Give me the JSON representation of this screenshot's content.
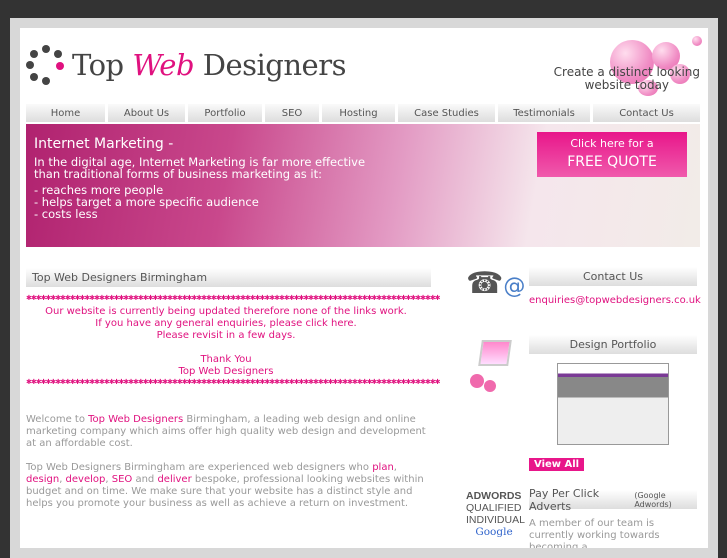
{
  "logo": {
    "part1": "Top ",
    "part2": "Web",
    "part3": " Designers"
  },
  "tagline": {
    "line1": "Create a distinct looking",
    "line2": "website today"
  },
  "nav": [
    "Home",
    "About Us",
    "Portfolio",
    "SEO",
    "Hosting",
    "Case Studies",
    "Testimonials",
    "Contact Us"
  ],
  "banner": {
    "title": "Internet Marketing -",
    "line1": "In the digital age, Internet Marketing is far more effective",
    "line2": "than traditional forms of business marketing as it:",
    "bullets": [
      "- reaches more people",
      "- helps target a more specific audience",
      "- costs less"
    ]
  },
  "quote": {
    "line1": "Click here for a",
    "line2": "FREE QUOTE"
  },
  "main": {
    "heading": "Top Web Designers Birmingham",
    "notice": [
      "Our website is currently being updated therefore none of the links work.",
      "If you have any general enquiries, please click here.",
      "Please revisit in a few days.",
      "Thank You",
      "Top Web Designers"
    ],
    "p1": {
      "a": "Welcome to ",
      "link": "Top Web Designers",
      "b": " Birmingham, a leading web design and online marketing company which aims offer high quality web design and development at an affordable cost."
    },
    "p2": {
      "a": "Top Web Designers Birmingham are experienced web designers who ",
      "plan": "plan",
      "design": "design",
      "develop": "develop",
      "seo": "SEO",
      "deliver": "deliver",
      "b": " bespoke, professional looking websites within budget and on time. We make sure that your website has a distinct style and helps you promote your business as well as achieve a return on investment."
    }
  },
  "side": {
    "contact_heading": "Contact Us",
    "email": "enquiries@topwebdesigners.co.uk",
    "portfolio_heading": "Design Portfolio",
    "view_all": "View All",
    "ppc_heading": "Pay Per Click Adverts",
    "ppc_small": "(Google Adwords)",
    "ppc_text": "A member of our team is currently working towards becoming a",
    "badge": {
      "l1": "ADWORDS",
      "l2": "QUALIFIED",
      "l3": "INDIVIDUAL",
      "l4": "Google"
    }
  },
  "colors": {
    "accent": "#e0117f"
  }
}
